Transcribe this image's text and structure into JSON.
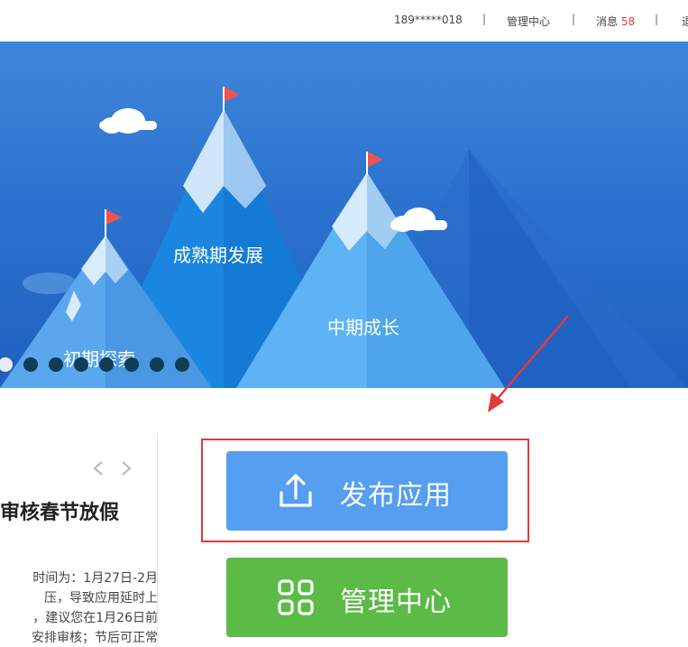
{
  "topbar": {
    "phone": "189*****018",
    "manage_center": "管理中心",
    "messages_label": "消息",
    "messages_count": "58",
    "truncated": "退"
  },
  "banner": {
    "peak_labels": [
      "初期探索",
      "成熟期发展",
      "中期成长"
    ],
    "slide_count": 8,
    "active_slide": 1
  },
  "news": {
    "title": "审核春节放假",
    "lines": [
      "时间为：1月27日-2月",
      "压，导致应用延时上",
      "，建议您在1月26日前",
      "安排审核；节后可正常"
    ]
  },
  "actions": {
    "publish_label": "发布应用",
    "manage_label": "管理中心"
  },
  "colors": {
    "publish": "#569ef0",
    "manage": "#5cba47",
    "highlight": "#e03a3a",
    "badge": "#e53935"
  }
}
